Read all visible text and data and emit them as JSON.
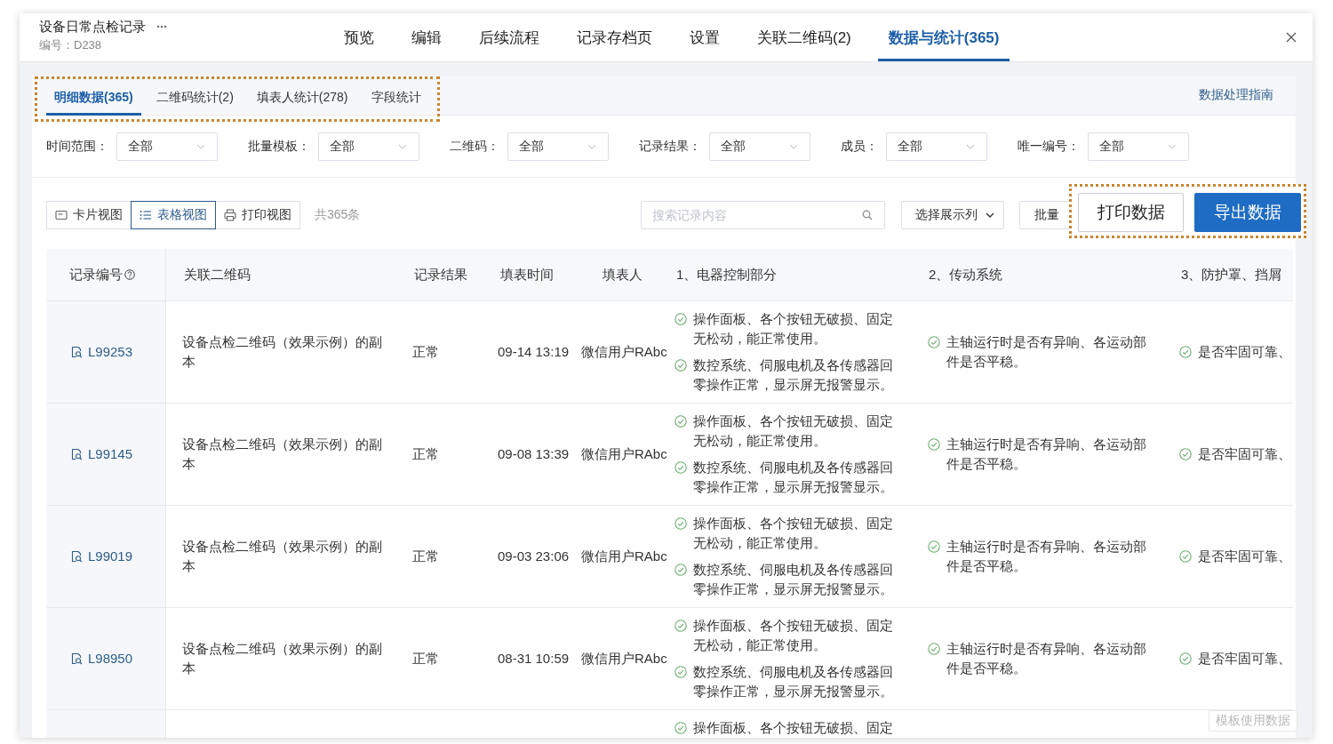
{
  "window": {
    "title": "设备日常点检记录",
    "code": "编号：D238"
  },
  "tabs": [
    {
      "label": "预览",
      "selected": false
    },
    {
      "label": "编辑",
      "selected": false
    },
    {
      "label": "后续流程",
      "selected": false
    },
    {
      "label": "记录存档页",
      "selected": false
    },
    {
      "label": "设置",
      "selected": false
    },
    {
      "label": "关联二维码(2)",
      "selected": false
    },
    {
      "label": "数据与统计(365)",
      "selected": true
    }
  ],
  "sub_tabs": {
    "highlighted": true,
    "items": [
      {
        "label": "明细数据(365)",
        "selected": true
      },
      {
        "label": "二维码统计(2)",
        "selected": false
      },
      {
        "label": "填表人统计(278)",
        "selected": false
      },
      {
        "label": "字段统计",
        "selected": false
      }
    ]
  },
  "guide_link": "数据处理指南",
  "filters": [
    {
      "label": "时间范围：",
      "value": "全部"
    },
    {
      "label": "批量模板：",
      "value": "全部"
    },
    {
      "label": "二维码：",
      "value": "全部"
    },
    {
      "label": "记录结果：",
      "value": "全部"
    },
    {
      "label": "成员：",
      "value": "全部"
    },
    {
      "label": "唯一编号：",
      "value": "全部"
    }
  ],
  "view_modes": [
    {
      "kind": "card",
      "label": "卡片视图",
      "selected": false
    },
    {
      "kind": "table",
      "label": "表格视图",
      "selected": true
    },
    {
      "kind": "print",
      "label": "打印视图",
      "selected": false
    }
  ],
  "total": "共365条",
  "search": {
    "placeholder": "搜索记录内容"
  },
  "column_picker": {
    "label": "选择展示列"
  },
  "batch_button": {
    "label": "批量"
  },
  "actions": {
    "highlighted": true,
    "buttons": [
      {
        "kind": "print",
        "label": "打印数据"
      },
      {
        "kind": "export",
        "label": "导出数据"
      }
    ]
  },
  "table": {
    "columns": [
      {
        "label": "记录编号",
        "help": true
      },
      {
        "label": "关联二维码",
        "help": false
      },
      {
        "label": "记录结果",
        "help": false
      },
      {
        "label": "填表时间",
        "help": false
      },
      {
        "label": "填表人",
        "help": false
      },
      {
        "label": "1、电器控制部分",
        "help": false
      },
      {
        "label": "2、传动系统",
        "help": false
      },
      {
        "label": "3、防护罩、挡屑",
        "help": false
      }
    ],
    "rows": [
      {
        "record_id": "L99253",
        "qr_code": "设备点检二维码（效果示例）的副本",
        "result": "正常",
        "time": "09-14 13:19",
        "user": "微信用户RAbc",
        "checks": [
          [
            "操作面板、各个按钮无破损、固定无松动，能正常使用。",
            "数控系统、伺服电机及各传感器回零操作正常，显示屏无报警显示。"
          ],
          [
            "主轴运行时是否有异响、各运动部件是否平稳。"
          ],
          [
            "是否牢固可靠、"
          ]
        ]
      },
      {
        "record_id": "L99145",
        "qr_code": "设备点检二维码（效果示例）的副本",
        "result": "正常",
        "time": "09-08 13:39",
        "user": "微信用户RAbc",
        "checks": [
          [
            "操作面板、各个按钮无破损、固定无松动，能正常使用。",
            "数控系统、伺服电机及各传感器回零操作正常，显示屏无报警显示。"
          ],
          [
            "主轴运行时是否有异响、各运动部件是否平稳。"
          ],
          [
            "是否牢固可靠、"
          ]
        ]
      },
      {
        "record_id": "L99019",
        "qr_code": "设备点检二维码（效果示例）的副本",
        "result": "正常",
        "time": "09-03 23:06",
        "user": "微信用户RAbc",
        "checks": [
          [
            "操作面板、各个按钮无破损、固定无松动，能正常使用。",
            "数控系统、伺服电机及各传感器回零操作正常，显示屏无报警显示。"
          ],
          [
            "主轴运行时是否有异响、各运动部件是否平稳。"
          ],
          [
            "是否牢固可靠、"
          ]
        ]
      },
      {
        "record_id": "L98950",
        "qr_code": "设备点检二维码（效果示例）的副本",
        "result": "正常",
        "time": "08-31 10:59",
        "user": "微信用户RAbc",
        "checks": [
          [
            "操作面板、各个按钮无破损、固定无松动，能正常使用。",
            "数控系统、伺服电机及各传感器回零操作正常，显示屏无报警显示。"
          ],
          [
            "主轴运行时是否有异响、各运动部件是否平稳。"
          ],
          [
            "是否牢固可靠、"
          ]
        ]
      },
      {
        "checks": [
          [
            "操作面板、各个按钮无破损、固定"
          ]
        ]
      }
    ]
  },
  "floating_button": {
    "label": "模板使用数据"
  }
}
